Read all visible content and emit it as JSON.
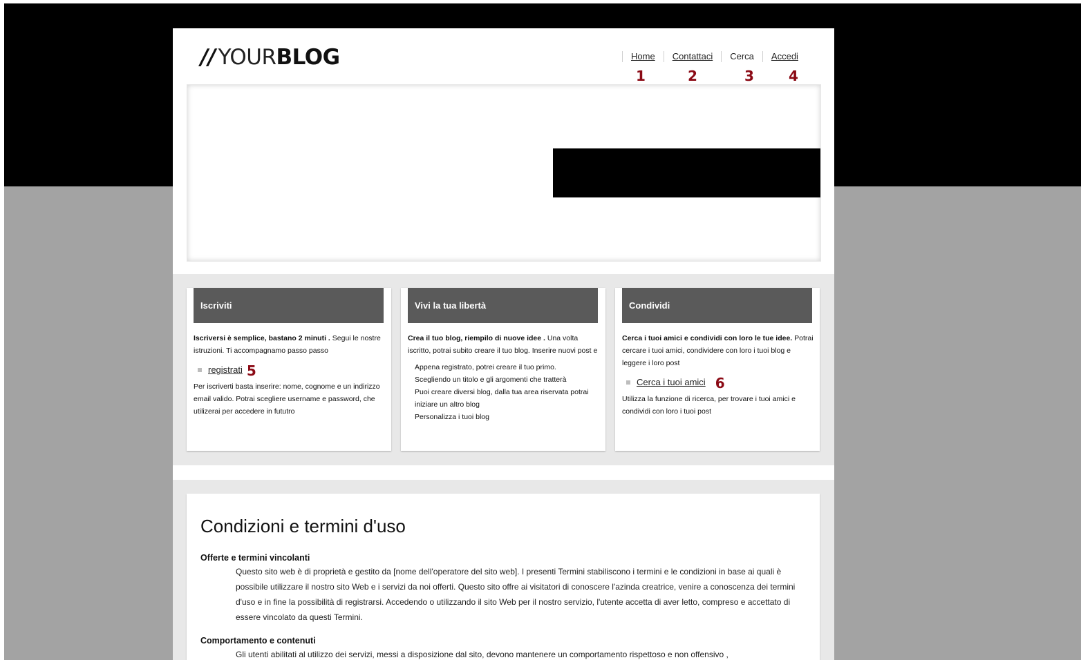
{
  "logo": {
    "slashes": "//",
    "light": "YOUR",
    "bold": "BLOG"
  },
  "nav": {
    "items": [
      "Home",
      "Contattaci",
      "Cerca",
      "Accedi"
    ]
  },
  "markers": [
    "1",
    "2",
    "3",
    "4",
    "5",
    "6"
  ],
  "cards": [
    {
      "title": "Iscriviti",
      "lead_bold": "Iscriversi è semplice, bastano 2 minuti .",
      "lead_rest": " Segui le nostre istruzioni. Ti accompagnamo passo passo",
      "link": "registrati",
      "after": "Per iscriverti basta inserire: nome, cognome e un indirizzo email valido. Potrai scegliere username e password, che utilizerai per accedere in fututro"
    },
    {
      "title": "Vivi la tua libertà",
      "lead_bold": "Crea il tuo blog, riempilo di nuove idee .",
      "lead_rest": " Una volta iscritto, potrai subito creare il tuo blog. Inserire nuovi post e",
      "list": [
        "Appena registrato, potrei creare il tuo primo.",
        "Scegliendo un titolo e gli argomenti che tratterà",
        "Puoi creare diversi blog, dalla tua area riservata potrai iniziare un altro blog",
        "Personalizza i tuoi blog"
      ]
    },
    {
      "title": "Condividi",
      "lead_bold": "Cerca i tuoi amici e condividi con loro le tue idee.",
      "lead_rest": " Potrai cercare i tuoi amici, condividere con loro i tuoi blog e leggere i loro post",
      "link": "Cerca i tuoi amici",
      "after": "Utilizza la funzione di ricerca, per trovare i tuoi amici e condividi con loro i tuoi post"
    }
  ],
  "terms": {
    "title": "Condizioni e termini d'uso",
    "sections": [
      {
        "heading": "Offerte e termini vincolanti",
        "text": "Questo sito web è di proprietà e gestito da [nome dell'operatore del sito web]. I presenti Termini stabiliscono i termini e le condizioni in base ai quali è possibile utilizzare il nostro sito Web e i servizi da noi offerti. Questo sito offre ai visitatori di conoscere l'azinda creatrice, venire a conoscenza dei termini d'uso e in fine la possibilità di registrarsi. Accedendo o utilizzando il sito Web per il nostro servizio, l'utente accetta di aver letto, compreso e accettato di essere vincolato da questi Termini."
      },
      {
        "heading": "Comportamento e contenuti",
        "text": "Gli utenti abilitati al utilizzo dei servizi, messi a disposizione dal sito, devono mantenere un comportamento rispettoso e non offensivo ,"
      }
    ]
  },
  "colors": {
    "marker": "#8b0a15",
    "card_head": "#5a5a5a",
    "band": "#e8e8e8"
  }
}
